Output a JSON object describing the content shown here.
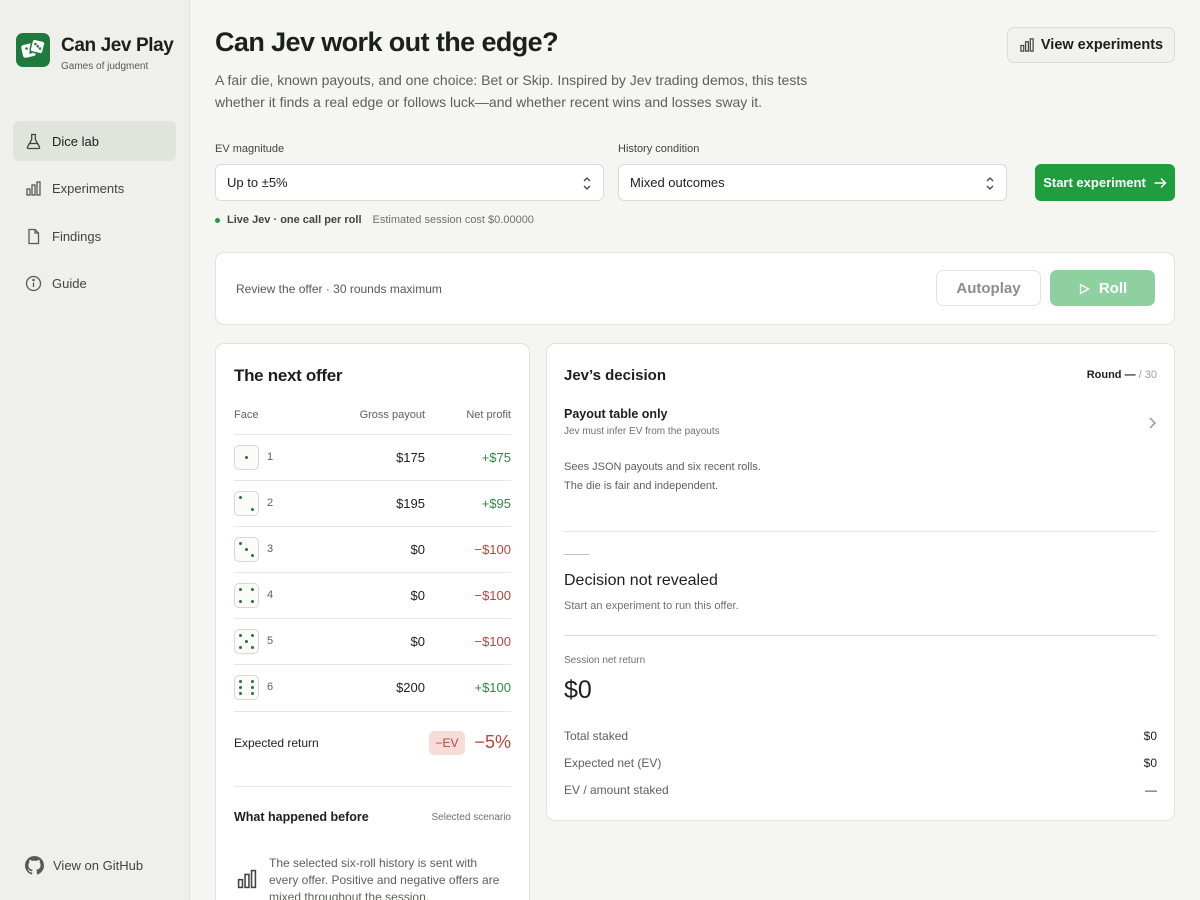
{
  "brand": {
    "title": "Can Jev Play",
    "subtitle": "Games of judgment"
  },
  "sidebar": {
    "items": [
      {
        "label": "Dice lab",
        "icon": "flask-icon",
        "active": true
      },
      {
        "label": "Experiments",
        "icon": "bar-chart-icon"
      },
      {
        "label": "Findings",
        "icon": "document-icon"
      },
      {
        "label": "Guide",
        "icon": "info-icon"
      }
    ],
    "github_label": "View on GitHub"
  },
  "header": {
    "title": "Can Jev work out the edge?",
    "description": "A fair die, known payouts, and one choice: Bet or Skip. Inspired by Jev trading demos, this tests whether it finds a real edge or follows luck—and whether recent wins and losses sway it.",
    "view_experiments_label": "View experiments"
  },
  "controls": {
    "ev_label": "EV magnitude",
    "ev_value": "Up to ±5%",
    "history_label": "History condition",
    "history_value": "Mixed outcomes",
    "start_label": "Start experiment",
    "live_label": "Live Jev · one call per roll",
    "cost_label": "Estimated session cost $0.00000"
  },
  "offer_bar": {
    "text": "Review the offer · 30 rounds maximum",
    "autoplay_label": "Autoplay",
    "roll_label": "Roll"
  },
  "next_offer": {
    "title": "The next offer",
    "columns": [
      "Face",
      "Gross payout",
      "Net profit"
    ],
    "rows": [
      {
        "face": "1",
        "gross": "$175",
        "net": "+$75",
        "positive": true
      },
      {
        "face": "2",
        "gross": "$195",
        "net": "+$95",
        "positive": true
      },
      {
        "face": "3",
        "gross": "$0",
        "net": "−$100",
        "positive": false
      },
      {
        "face": "4",
        "gross": "$0",
        "net": "−$100",
        "positive": false
      },
      {
        "face": "5",
        "gross": "$0",
        "net": "−$100",
        "positive": false
      },
      {
        "face": "6",
        "gross": "$200",
        "net": "+$100",
        "positive": true
      }
    ],
    "expected_label": "Expected return",
    "ev_badge": "−EV",
    "ev_value": "−5%",
    "before_title": "What happened before",
    "before_tag": "Selected scenario",
    "before_text": "The selected six-roll history is sent with every offer. Positive and negative offers are mixed throughout the session."
  },
  "decision": {
    "title": "Jev’s decision",
    "round_label": "Round —",
    "round_total": "/ 30",
    "payout_title": "Payout table only",
    "payout_sub": "Jev must infer EV from the payouts",
    "payout_line1": "Sees JSON payouts and six recent rolls.",
    "payout_line2": "The die is fair and independent.",
    "not_revealed_title": "Decision not revealed",
    "not_revealed_sub": "Start an experiment to run this offer.",
    "session_label": "Session net return",
    "session_value": "$0",
    "stats": [
      {
        "label": "Total staked",
        "value": "$0"
      },
      {
        "label": "Expected net (EV)",
        "value": "$0"
      },
      {
        "label": "EV / amount staked",
        "value": "—"
      }
    ]
  },
  "colors": {
    "accent": "#1f9d3f",
    "positive": "#2e8a47",
    "negative": "#b2463b"
  }
}
